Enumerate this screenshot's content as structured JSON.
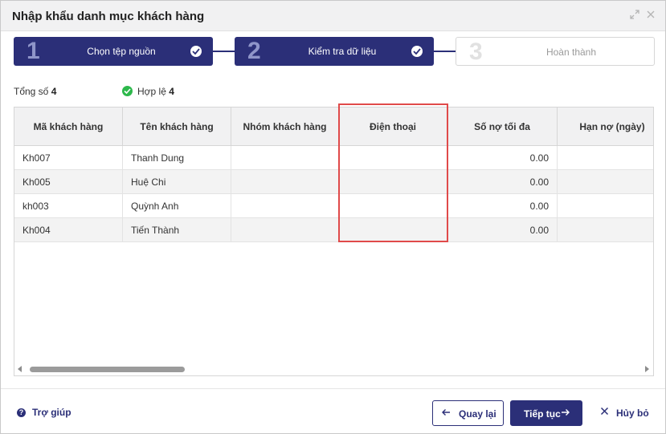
{
  "dialog": {
    "title": "Nhập khẩu danh mục khách hàng",
    "expand_icon": "expand-icon",
    "close_icon": "close-icon"
  },
  "steps": [
    {
      "number": "1",
      "label": "Chọn tệp nguồn",
      "state": "done"
    },
    {
      "number": "2",
      "label": "Kiểm tra dữ liệu",
      "state": "done"
    },
    {
      "number": "3",
      "label": "Hoàn thành",
      "state": "pending"
    }
  ],
  "summary": {
    "total_label": "Tổng số",
    "total_value": "4",
    "valid_label": "Hợp lệ",
    "valid_value": "4"
  },
  "table": {
    "columns": [
      "Mã khách hàng",
      "Tên khách hàng",
      "Nhóm khách hàng",
      "Điện thoại",
      "Số nợ tối đa",
      "Hạn nợ (ngày)"
    ],
    "rows": [
      [
        "Kh007",
        "Thanh Dung",
        "",
        "",
        "0.00",
        ""
      ],
      [
        "Kh005",
        "Huệ Chi",
        "",
        "",
        "0.00",
        ""
      ],
      [
        "kh003",
        "Quỳnh Anh",
        "",
        "",
        "0.00",
        ""
      ],
      [
        "Kh004",
        "Tiến Thành",
        "",
        "",
        "0.00",
        ""
      ]
    ],
    "highlighted_column": "Điện thoại"
  },
  "footer": {
    "help_label": "Trợ giúp",
    "back_label": "Quay lại",
    "next_label": "Tiếp tục",
    "cancel_label": "Hủy bỏ"
  },
  "colors": {
    "primary": "#2b2f78",
    "step_number_active": "#8f95c9",
    "valid_green": "#2db84b",
    "highlight_red": "#e04a4a"
  }
}
